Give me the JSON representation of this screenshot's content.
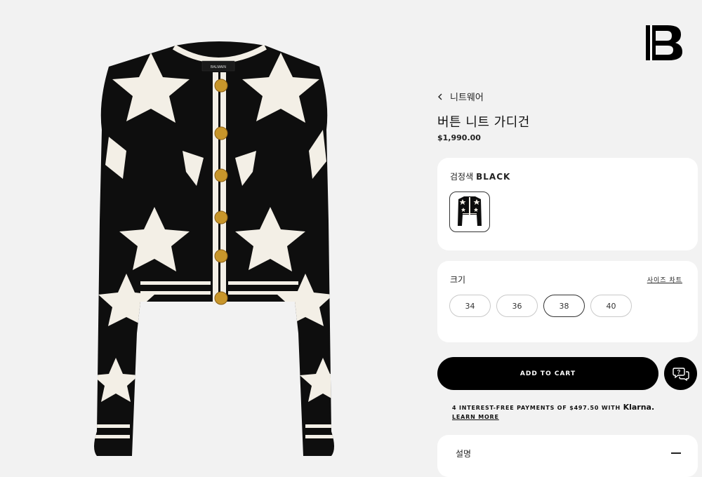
{
  "brand": {
    "logo_letter": "B"
  },
  "product": {
    "breadcrumb": "니트웨어",
    "title": "버튼 니트 가디건",
    "price": "$1,990.00",
    "label_brand": "BALMAIN"
  },
  "color": {
    "label": "검정색",
    "value": "BLACK",
    "swatch_color": "#0d0d0d"
  },
  "size": {
    "label": "크기",
    "chart_link": "사이즈 차트",
    "options": [
      "34",
      "36",
      "38",
      "40"
    ],
    "selected": "38"
  },
  "actions": {
    "add_to_cart": "ADD TO CART",
    "help_icon": "chat-help-icon"
  },
  "klarna": {
    "text": "4 INTEREST-FREE PAYMENTS OF $497.50 WITH",
    "brand": "Klarna.",
    "learn_more": "LEARN MORE"
  },
  "description": {
    "label": "설명"
  },
  "colors": {
    "background": "#f2f2f2",
    "card": "#ffffff",
    "button": "#000000",
    "garment": "#0e0e0e",
    "star": "#f3efe6",
    "button_gold": "#c8962b"
  }
}
